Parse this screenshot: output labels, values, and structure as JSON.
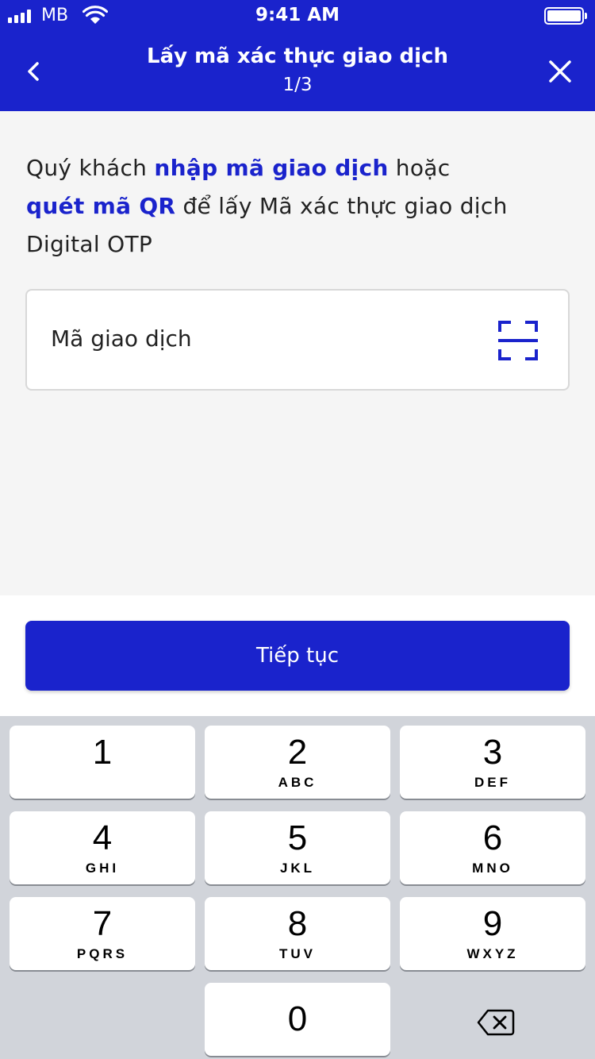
{
  "status": {
    "carrier": "MB",
    "time": "9:41 AM"
  },
  "header": {
    "title": "Lấy mã xác thực giao dịch",
    "step": "1/3"
  },
  "description": {
    "part1": "Quý khách ",
    "highlight1": "nhập mã giao dịch",
    "part2": " hoặc ",
    "highlight2": "quét mã QR",
    "part3": " để lấy Mã xác thực giao dịch Digital OTP"
  },
  "transaction_field": {
    "placeholder": "Mã giao dịch"
  },
  "continue_label": "Tiếp tục",
  "keypad": {
    "keys": [
      {
        "num": "1",
        "letters": ""
      },
      {
        "num": "2",
        "letters": "ABC"
      },
      {
        "num": "3",
        "letters": "DEF"
      },
      {
        "num": "4",
        "letters": "GHI"
      },
      {
        "num": "5",
        "letters": "JKL"
      },
      {
        "num": "6",
        "letters": "MNO"
      },
      {
        "num": "7",
        "letters": "PQRS"
      },
      {
        "num": "8",
        "letters": "TUV"
      },
      {
        "num": "9",
        "letters": "WXYZ"
      },
      {
        "num": "0",
        "letters": ""
      }
    ]
  },
  "colors": {
    "brand": "#1a23cc",
    "background": "#f5f5f5",
    "keypad": "#d1d4da"
  }
}
